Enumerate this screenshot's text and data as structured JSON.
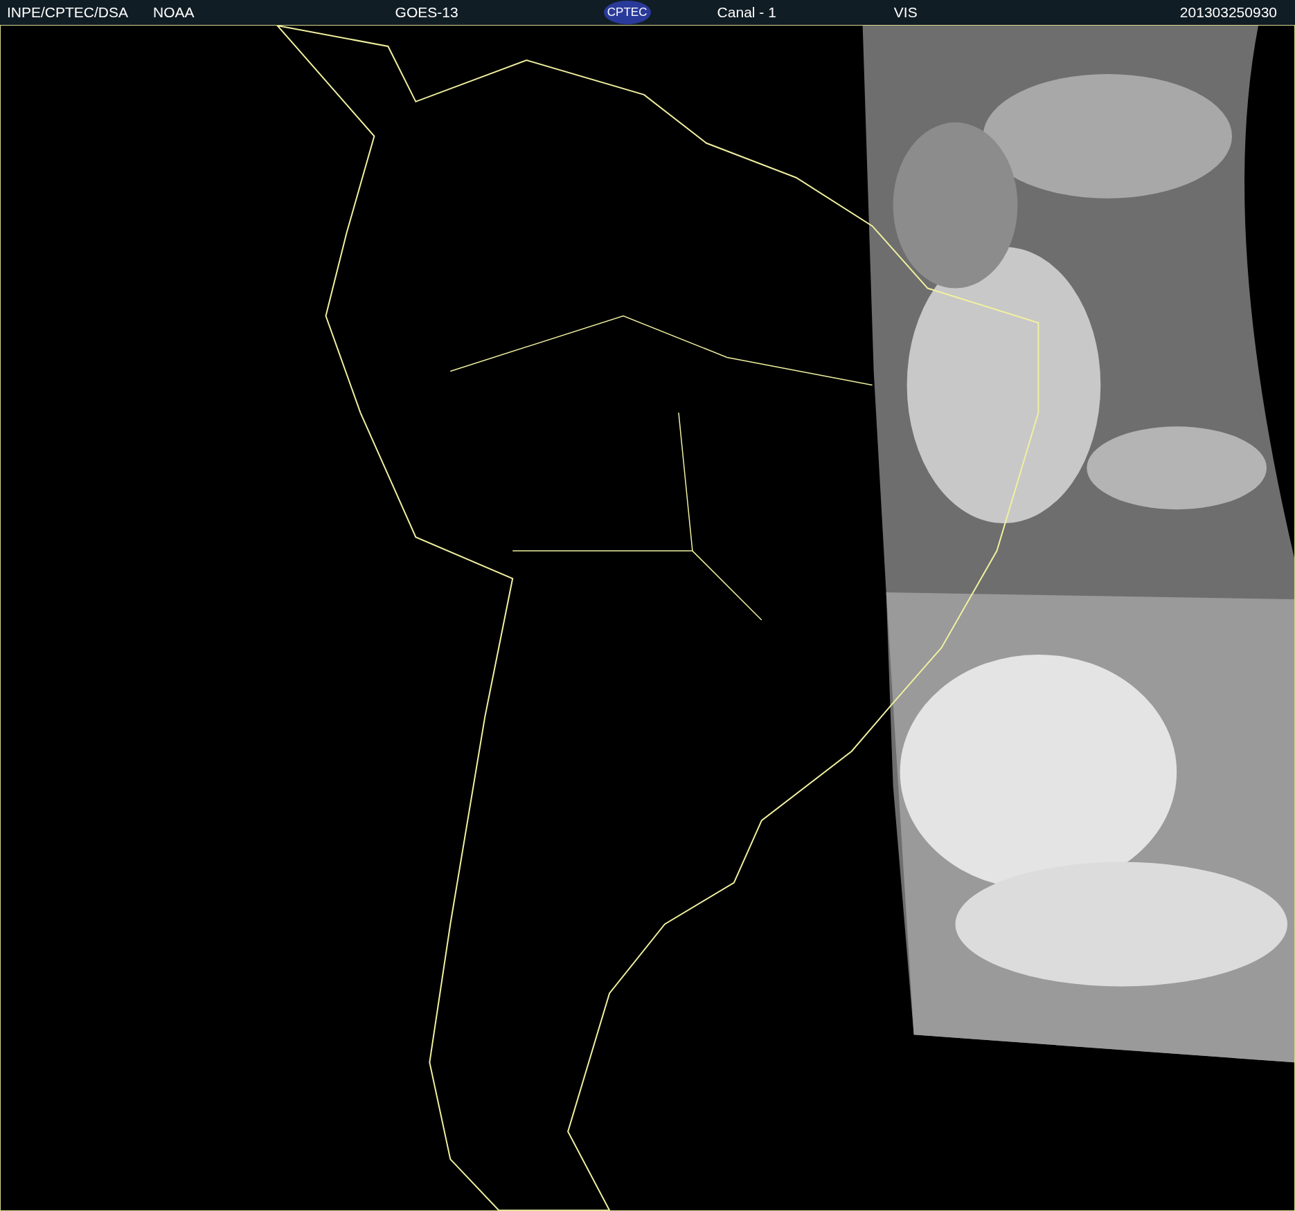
{
  "header": {
    "source": "INPE/CPTEC/DSA",
    "agency": "NOAA",
    "satellite": "GOES-13",
    "logo": "CPTEC",
    "channel": "Canal - 1",
    "band": "VIS",
    "timestamp": "201303250930"
  }
}
